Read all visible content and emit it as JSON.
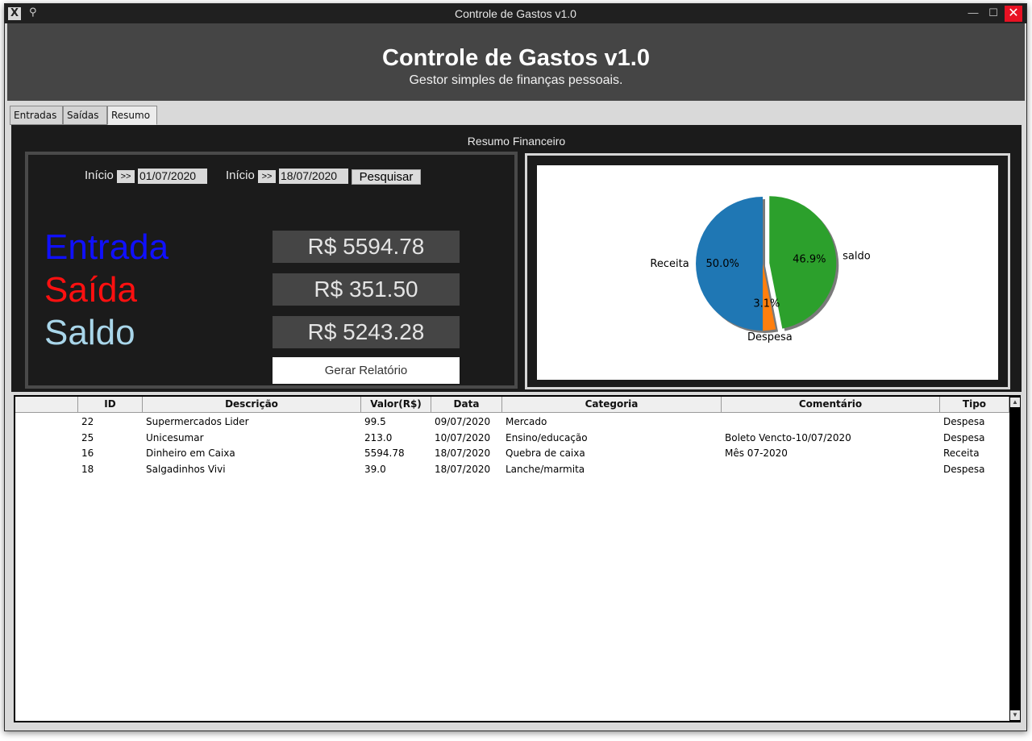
{
  "window": {
    "title": "Controle de Gastos v1.0"
  },
  "titlebar": {
    "pin_icon": "pin-icon",
    "minimize": "—",
    "maximize": "☐",
    "close": "✕"
  },
  "header": {
    "title": "Controle de Gastos v1.0",
    "subtitle": "Gestor simples de finanças pessoais."
  },
  "tabs": [
    {
      "label": "Entradas",
      "active": false
    },
    {
      "label": "Saídas",
      "active": false
    },
    {
      "label": "Resumo",
      "active": true
    }
  ],
  "resumo": {
    "title": "Resumo Financeiro",
    "start_label": "Início",
    "start_arrow": ">>",
    "start_date": "01/07/2020",
    "end_label": "Início",
    "end_arrow": ">>",
    "end_date": "18/07/2020",
    "search_button": "Pesquisar",
    "entrada_label": "Entrada",
    "saida_label": "Saída",
    "saldo_label": "Saldo",
    "entrada_value": "R$ 5594.78",
    "saida_value": "R$ 351.50",
    "saldo_value": "R$ 5243.28",
    "report_button": "Gerar Relatório",
    "colors": {
      "entrada": "#1010ff",
      "saida": "#ff1010",
      "saldo": "#a9d6ea"
    }
  },
  "chart_data": {
    "type": "pie",
    "slices": [
      {
        "label": "Receita",
        "value": 50.0,
        "pct_label": "50.0%",
        "color": "#1f77b4"
      },
      {
        "label": "Despesa",
        "value": 3.1,
        "pct_label": "3.1%",
        "color": "#ff7f0e"
      },
      {
        "label": "saldo",
        "value": 46.9,
        "pct_label": "46.9%",
        "color": "#2ca02c"
      }
    ],
    "start_angle": 90,
    "explode": [
      0,
      0,
      0.1
    ],
    "shadow": true
  },
  "table": {
    "columns": [
      "",
      "ID",
      "Descrição",
      "Valor(R$)",
      "Data",
      "Categoria",
      "Comentário",
      "Tipo"
    ],
    "rows": [
      {
        "id": "22",
        "descricao": "Supermercados Lider",
        "valor": "99.5",
        "data": "09/07/2020",
        "categoria": "Mercado",
        "comentario": "",
        "tipo": "Despesa"
      },
      {
        "id": "25",
        "descricao": "Unicesumar",
        "valor": "213.0",
        "data": "10/07/2020",
        "categoria": "Ensino/educação",
        "comentario": "Boleto Vencto-10/07/2020",
        "tipo": "Despesa"
      },
      {
        "id": "16",
        "descricao": "Dinheiro em Caixa",
        "valor": "5594.78",
        "data": "18/07/2020",
        "categoria": "Quebra de caixa",
        "comentario": "Mês 07-2020",
        "tipo": "Receita"
      },
      {
        "id": "18",
        "descricao": "Salgadinhos Vivi",
        "valor": "39.0",
        "data": "18/07/2020",
        "categoria": "Lanche/marmita",
        "comentario": "",
        "tipo": "Despesa"
      }
    ]
  }
}
